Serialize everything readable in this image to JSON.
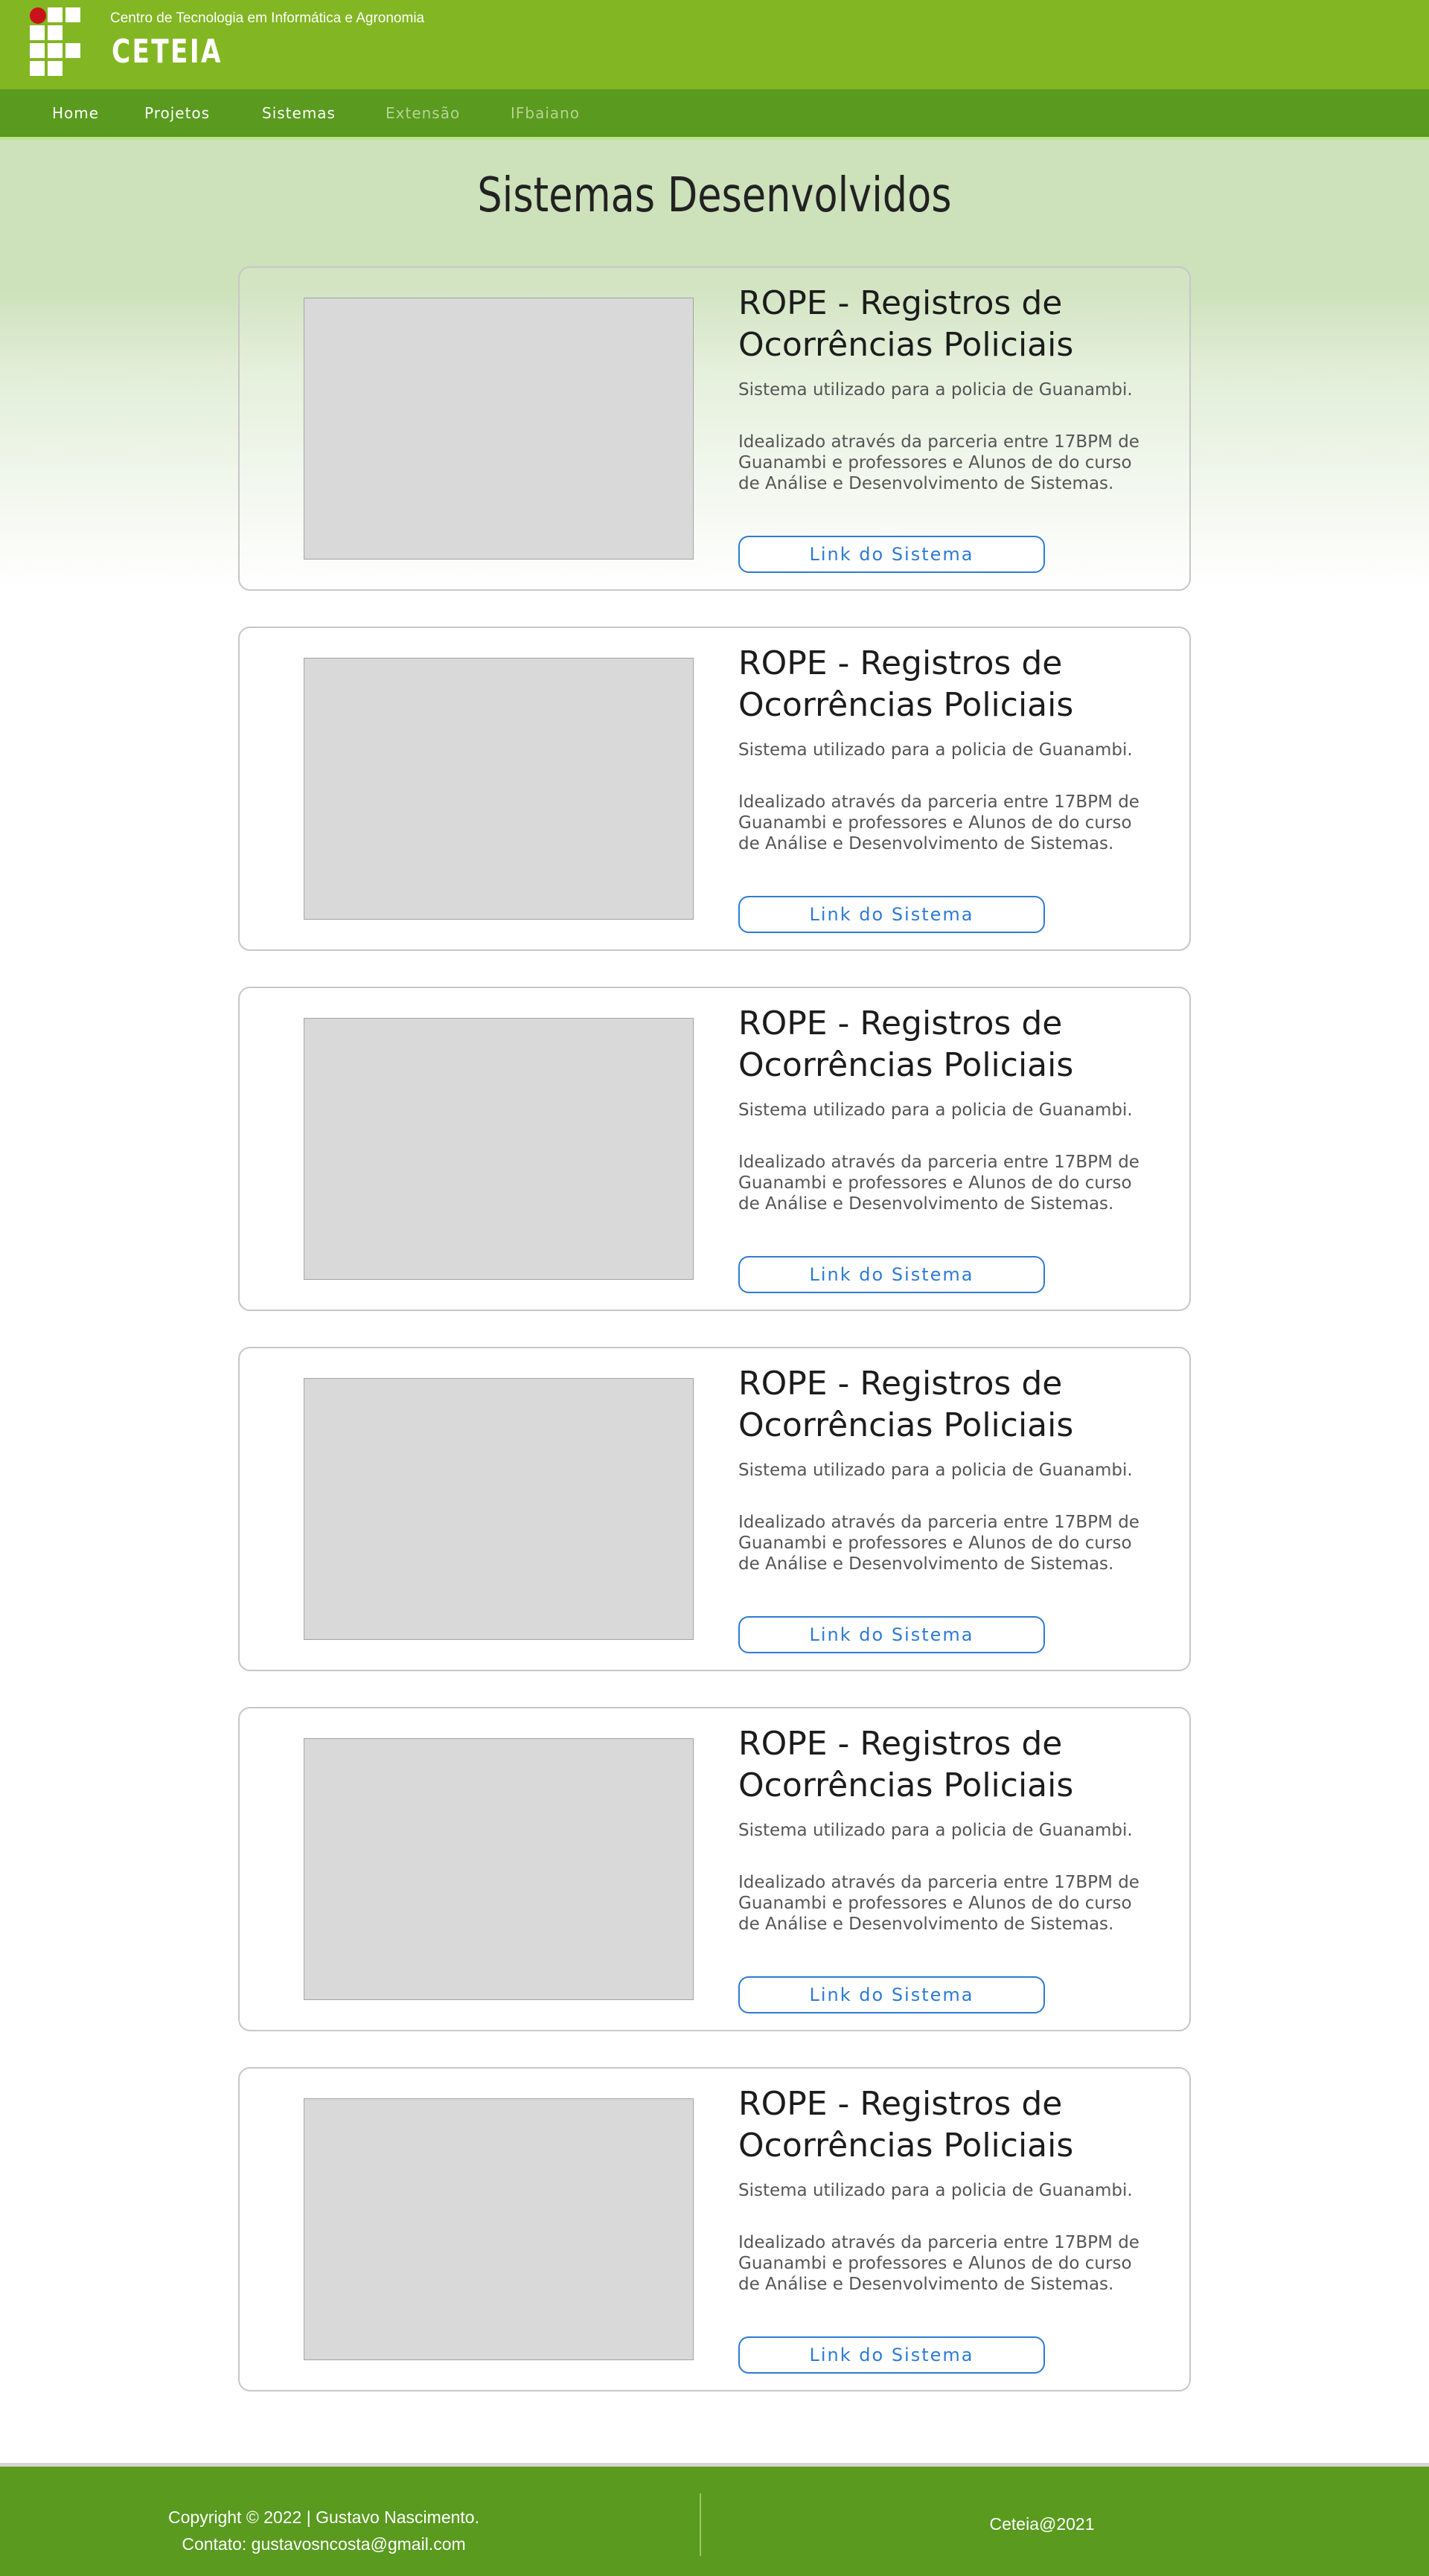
{
  "header": {
    "subtitle": "Centro de Tecnologia em Informática e Agronomia",
    "title": "CETEIA",
    "logo_icon": "ifbaiano-logo-icon",
    "colors": {
      "header_bg": "#83b623",
      "nav_bg": "#599a1f",
      "logo_dot": "#c8131b"
    }
  },
  "nav": {
    "items": [
      {
        "label": "Home"
      },
      {
        "label": "Projetos"
      },
      {
        "label": "Sistemas"
      },
      {
        "label": "Extensão"
      },
      {
        "label": "IFbaiano"
      }
    ]
  },
  "main": {
    "page_title": "Sistemas Desenvolvidos",
    "cards": [
      {
        "title": "ROPE - Registros de Ocorrências Policiais",
        "desc1": "Sistema utilizado para a policia de Guanambi.",
        "desc2": "Idealizado através da parceria entre 17BPM de Guanambi e professores e Alunos de do curso de Análise e Desenvolvimento de Sistemas.",
        "button": "Link do Sistema"
      },
      {
        "title": "ROPE - Registros de Ocorrências Policiais",
        "desc1": "Sistema utilizado para a policia de Guanambi.",
        "desc2": "Idealizado através da parceria entre 17BPM de Guanambi e professores e Alunos de do curso de Análise e Desenvolvimento de Sistemas.",
        "button": "Link do Sistema"
      },
      {
        "title": "ROPE - Registros de Ocorrências Policiais",
        "desc1": "Sistema utilizado para a policia de Guanambi.",
        "desc2": "Idealizado através da parceria entre 17BPM de Guanambi e professores e Alunos de do curso de Análise e Desenvolvimento de Sistemas.",
        "button": "Link do Sistema"
      },
      {
        "title": "ROPE - Registros de Ocorrências Policiais",
        "desc1": "Sistema utilizado para a policia de Guanambi.",
        "desc2": "Idealizado através da parceria entre 17BPM de Guanambi e professores e Alunos de do curso de Análise e Desenvolvimento de Sistemas.",
        "button": "Link do Sistema"
      },
      {
        "title": "ROPE - Registros de Ocorrências Policiais",
        "desc1": "Sistema utilizado para a policia de Guanambi.",
        "desc2": "Idealizado através da parceria entre 17BPM de Guanambi e professores e Alunos de do curso de Análise e Desenvolvimento de Sistemas.",
        "button": "Link do Sistema"
      },
      {
        "title": "ROPE - Registros de Ocorrências Policiais",
        "desc1": "Sistema utilizado para a policia de Guanambi.",
        "desc2": "Idealizado através da parceria entre 17BPM de Guanambi e professores e Alunos de do curso de Análise e Desenvolvimento de Sistemas.",
        "button": "Link do Sistema"
      }
    ]
  },
  "footer": {
    "copyright": "Copyright © 2022 | Gustavo Nascimento.",
    "contact": "Contato: gustavosncosta@gmail.com",
    "right": "Ceteia@2021"
  }
}
